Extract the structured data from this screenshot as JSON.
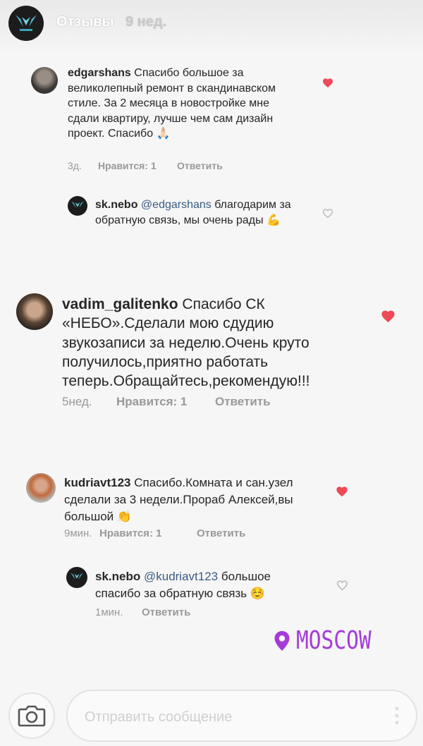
{
  "header": {
    "title": "Отзывы",
    "time": "9 нед."
  },
  "comments": [
    {
      "username": "edgarshans",
      "text": "Спасибо большое за великолепный ремонт в скандинавском стиле. За 2 месяца в новостройке мне сдали квартиру, лучше чем сам дизайн проект. Спасибо 🙏🏻",
      "time": "3д.",
      "likes": "Нравится: 1",
      "reply": "Ответить",
      "liked": true
    },
    {
      "username": "sk.nebo",
      "mention": "@edgarshans",
      "text": "благодарим за обратную связь, мы очень рады 💪",
      "liked": false
    },
    {
      "username": "vadim_galitenko",
      "text": "Спасибо СК «НЕБО».Сделали мою сдудию звукозаписи за неделю.Очень круто получилось,приятно работать теперь.Обращайтесь,рекомендую!!!",
      "time": "5нед.",
      "likes": "Нравится: 1",
      "reply": "Ответить",
      "liked": true
    },
    {
      "username": "kudriavt123",
      "text": "Спасибо.Комната и сан.узел сделали за 3 недели.Прораб Алексей,вы большой 👏",
      "time": "9мин.",
      "likes": "Нравится: 1",
      "reply": "Ответить",
      "liked": true
    },
    {
      "username": "sk.nebo",
      "mention": "@kudriavt123",
      "text": "большое спасибо за обратную связь ☺️",
      "time": "1мин.",
      "reply": "Ответить",
      "liked": false
    }
  ],
  "location": {
    "label": "MOSCOW",
    "icon": "location-pin-icon",
    "color": "#a43bd9"
  },
  "footer": {
    "placeholder": "Отправить сообщение"
  },
  "colors": {
    "heart_liked": "#ed4956",
    "mention": "#3b5b83"
  }
}
